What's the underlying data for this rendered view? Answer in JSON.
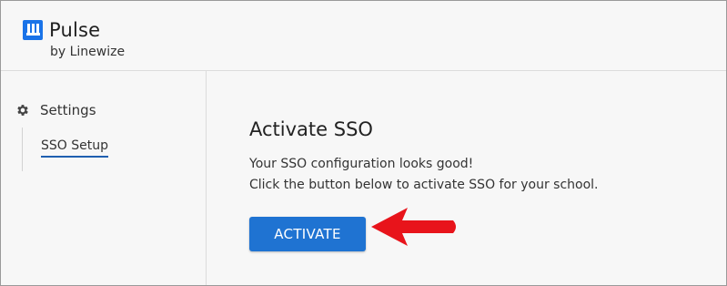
{
  "app": {
    "name": "Pulse",
    "subtitle": "by Linewize",
    "logo_icon": "pulse-logo-icon",
    "brand_color": "#1a73e8"
  },
  "sidebar": {
    "section_label": "Settings",
    "section_icon": "gear-icon",
    "items": [
      {
        "label": "SSO Setup",
        "active": true
      }
    ]
  },
  "main": {
    "title": "Activate SSO",
    "message_line1": "Your SSO configuration looks good!",
    "message_line2": "Click the button below to activate SSO for your school.",
    "button_label": "ACTIVATE",
    "button_color": "#1f73d2"
  },
  "annotation": {
    "icon": "red-arrow-icon",
    "color": "#e8141b"
  }
}
